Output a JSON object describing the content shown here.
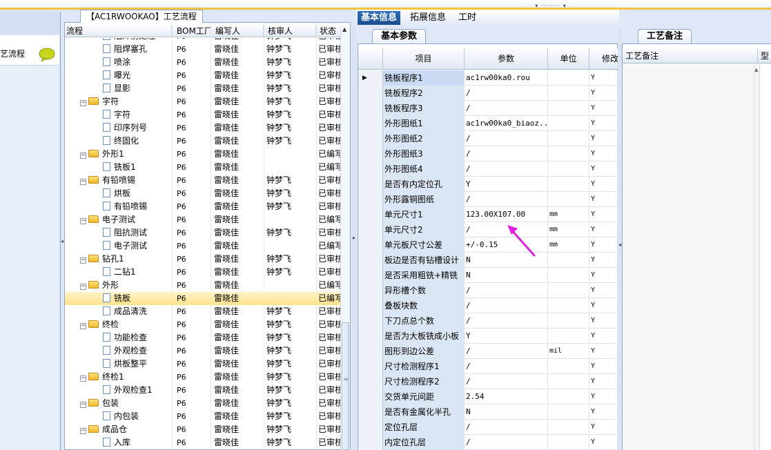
{
  "left_panel": {
    "item_label": "艺流程"
  },
  "tree": {
    "title": "【AC1RWOOKAO】工艺流程",
    "columns": [
      "流程",
      "BOM工厂",
      "编写人",
      "核审人",
      "状态"
    ],
    "rows": [
      {
        "kind": "doc",
        "name": "阻焊前处理",
        "bom": "P6",
        "writer": "雷晓佳",
        "reviewer": "钟梦飞",
        "status": "已审核"
      },
      {
        "kind": "doc",
        "name": "阻焊塞孔",
        "bom": "P6",
        "writer": "雷晓佳",
        "reviewer": "钟梦飞",
        "status": "已审核"
      },
      {
        "kind": "doc",
        "name": "喷涂",
        "bom": "P6",
        "writer": "雷晓佳",
        "reviewer": "钟梦飞",
        "status": "已审核"
      },
      {
        "kind": "doc",
        "name": "曝光",
        "bom": "P6",
        "writer": "雷晓佳",
        "reviewer": "钟梦飞",
        "status": "已审核"
      },
      {
        "kind": "doc",
        "name": "显影",
        "bom": "P6",
        "writer": "雷晓佳",
        "reviewer": "钟梦飞",
        "status": "已审核"
      },
      {
        "kind": "folder",
        "name": "字符",
        "bom": "P6",
        "writer": "雷晓佳",
        "reviewer": "钟梦飞",
        "status": "已审核"
      },
      {
        "kind": "doc",
        "name": "字符",
        "bom": "P6",
        "writer": "雷晓佳",
        "reviewer": "钟梦飞",
        "status": "已审核"
      },
      {
        "kind": "doc",
        "name": "印序列号",
        "bom": "P6",
        "writer": "雷晓佳",
        "reviewer": "钟梦飞",
        "status": "已审核"
      },
      {
        "kind": "doc",
        "name": "终固化",
        "bom": "P6",
        "writer": "雷晓佳",
        "reviewer": "钟梦飞",
        "status": "已审核"
      },
      {
        "kind": "folder",
        "name": "外形1",
        "bom": "P6",
        "writer": "雷晓佳",
        "reviewer": "",
        "status": "已编写"
      },
      {
        "kind": "doc",
        "name": "铣板1",
        "bom": "P6",
        "writer": "雷晓佳",
        "reviewer": "",
        "status": "已编写"
      },
      {
        "kind": "folder",
        "name": "有铅喷锡",
        "bom": "P6",
        "writer": "雷晓佳",
        "reviewer": "钟梦飞",
        "status": "已审核"
      },
      {
        "kind": "doc",
        "name": "烘板",
        "bom": "P6",
        "writer": "雷晓佳",
        "reviewer": "钟梦飞",
        "status": "已审核"
      },
      {
        "kind": "doc",
        "name": "有铅喷锡",
        "bom": "P6",
        "writer": "雷晓佳",
        "reviewer": "钟梦飞",
        "status": "已审核"
      },
      {
        "kind": "folder",
        "name": "电子测试",
        "bom": "P6",
        "writer": "雷晓佳",
        "reviewer": "",
        "status": "已编写"
      },
      {
        "kind": "doc",
        "name": "阻抗测试",
        "bom": "P6",
        "writer": "雷晓佳",
        "reviewer": "钟梦飞",
        "status": "已审核"
      },
      {
        "kind": "doc",
        "name": "电子测试",
        "bom": "P6",
        "writer": "雷晓佳",
        "reviewer": "",
        "status": "已编写"
      },
      {
        "kind": "folder",
        "name": "钻孔1",
        "bom": "P6",
        "writer": "雷晓佳",
        "reviewer": "钟梦飞",
        "status": "已审核"
      },
      {
        "kind": "doc",
        "name": "二钻1",
        "bom": "P6",
        "writer": "雷晓佳",
        "reviewer": "钟梦飞",
        "status": "已审核"
      },
      {
        "kind": "folder",
        "name": "外形",
        "bom": "P6",
        "writer": "雷晓佳",
        "reviewer": "",
        "status": "已编写"
      },
      {
        "kind": "doc",
        "name": "铣板",
        "bom": "P6",
        "writer": "雷晓佳",
        "reviewer": "",
        "status": "已编写",
        "selected": true
      },
      {
        "kind": "doc",
        "name": "成品清洗",
        "bom": "P6",
        "writer": "雷晓佳",
        "reviewer": "钟梦飞",
        "status": "已审核"
      },
      {
        "kind": "folder",
        "name": "终检",
        "bom": "P6",
        "writer": "雷晓佳",
        "reviewer": "钟梦飞",
        "status": "已审核"
      },
      {
        "kind": "doc",
        "name": "功能检查",
        "bom": "P6",
        "writer": "雷晓佳",
        "reviewer": "钟梦飞",
        "status": "已审核"
      },
      {
        "kind": "doc",
        "name": "外观检查",
        "bom": "P6",
        "writer": "雷晓佳",
        "reviewer": "钟梦飞",
        "status": "已审核"
      },
      {
        "kind": "doc",
        "name": "烘板整平",
        "bom": "P6",
        "writer": "雷晓佳",
        "reviewer": "钟梦飞",
        "status": "已审核"
      },
      {
        "kind": "folder",
        "name": "终检1",
        "bom": "P6",
        "writer": "雷晓佳",
        "reviewer": "钟梦飞",
        "status": "已审核"
      },
      {
        "kind": "doc",
        "name": "外观检查1",
        "bom": "P6",
        "writer": "雷晓佳",
        "reviewer": "钟梦飞",
        "status": "已审核"
      },
      {
        "kind": "folder",
        "name": "包装",
        "bom": "P6",
        "writer": "雷晓佳",
        "reviewer": "钟梦飞",
        "status": "已审核"
      },
      {
        "kind": "doc",
        "name": "内包装",
        "bom": "P6",
        "writer": "雷晓佳",
        "reviewer": "钟梦飞",
        "status": "已审核"
      },
      {
        "kind": "folder",
        "name": "成品仓",
        "bom": "P6",
        "writer": "雷晓佳",
        "reviewer": "钟梦飞",
        "status": "已审核"
      },
      {
        "kind": "doc",
        "name": "入库",
        "bom": "P6",
        "writer": "雷晓佳",
        "reviewer": "钟梦飞",
        "status": "已审核"
      }
    ]
  },
  "main_tabs": [
    {
      "label": "基本信息",
      "active": true
    },
    {
      "label": "拓展信息",
      "active": false
    },
    {
      "label": "工时",
      "active": false
    }
  ],
  "params": {
    "subtab": "基本参数",
    "columns": {
      "item": "项目",
      "param": "参数",
      "unit": "单位",
      "modify": "修改"
    },
    "rows": [
      {
        "item": "铣板程序1",
        "param": "ac1rw00ka0.rou",
        "unit": "",
        "mod": "Y",
        "current": true
      },
      {
        "item": "铣板程序2",
        "param": "/",
        "unit": "",
        "mod": "Y"
      },
      {
        "item": "铣板程序3",
        "param": "/",
        "unit": "",
        "mod": "Y"
      },
      {
        "item": "外形图纸1",
        "param": "ac1rw00ka0_biaoz...",
        "unit": "",
        "mod": "Y"
      },
      {
        "item": "外形图纸2",
        "param": "/",
        "unit": "",
        "mod": "Y"
      },
      {
        "item": "外形图纸3",
        "param": "/",
        "unit": "",
        "mod": "Y"
      },
      {
        "item": "外形图纸4",
        "param": "/",
        "unit": "",
        "mod": "Y"
      },
      {
        "item": "是否有内定位孔",
        "param": "Y",
        "unit": "",
        "mod": "Y"
      },
      {
        "item": "外形露铜图纸",
        "param": "/",
        "unit": "",
        "mod": "Y"
      },
      {
        "item": "单元尺寸1",
        "param": "123.00X107.00",
        "unit": "mm",
        "mod": "Y"
      },
      {
        "item": "单元尺寸2",
        "param": "/",
        "unit": "mm",
        "mod": "Y"
      },
      {
        "item": "单元板尺寸公差",
        "param": "+/-0.15",
        "unit": "mm",
        "mod": "Y"
      },
      {
        "item": "板边是否有钻槽设计",
        "param": "N",
        "unit": "",
        "mod": "Y"
      },
      {
        "item": "是否采用粗铣+精铣",
        "param": "N",
        "unit": "",
        "mod": "Y"
      },
      {
        "item": "异形槽个数",
        "param": "/",
        "unit": "",
        "mod": "Y"
      },
      {
        "item": "叠板块数",
        "param": "/",
        "unit": "",
        "mod": "Y"
      },
      {
        "item": "下刀点总个数",
        "param": "/",
        "unit": "",
        "mod": "Y"
      },
      {
        "item": "是否为大板铣成小板",
        "param": "Y",
        "unit": "",
        "mod": "Y"
      },
      {
        "item": "图形到边公差",
        "param": "/",
        "unit": "mil",
        "mod": "Y"
      },
      {
        "item": "尺寸检测程序1",
        "param": "/",
        "unit": "",
        "mod": "Y"
      },
      {
        "item": "尺寸检测程序2",
        "param": "/",
        "unit": "",
        "mod": "Y"
      },
      {
        "item": "交货单元间距",
        "param": "2.54",
        "unit": "",
        "mod": "Y"
      },
      {
        "item": "是否有金属化半孔",
        "param": "N",
        "unit": "",
        "mod": "Y"
      },
      {
        "item": "定位孔层",
        "param": "/",
        "unit": "",
        "mod": "Y"
      },
      {
        "item": "内定位孔层",
        "param": "/",
        "unit": "",
        "mod": "Y"
      }
    ]
  },
  "note": {
    "tab": "工艺备注",
    "header": "工艺备注",
    "header2": "型"
  },
  "colors": {
    "accent_tab": "#1a4d8f",
    "selection": "#ffe28a",
    "annotation_arrow": "#e020e0",
    "splitter": "#f2c244"
  }
}
